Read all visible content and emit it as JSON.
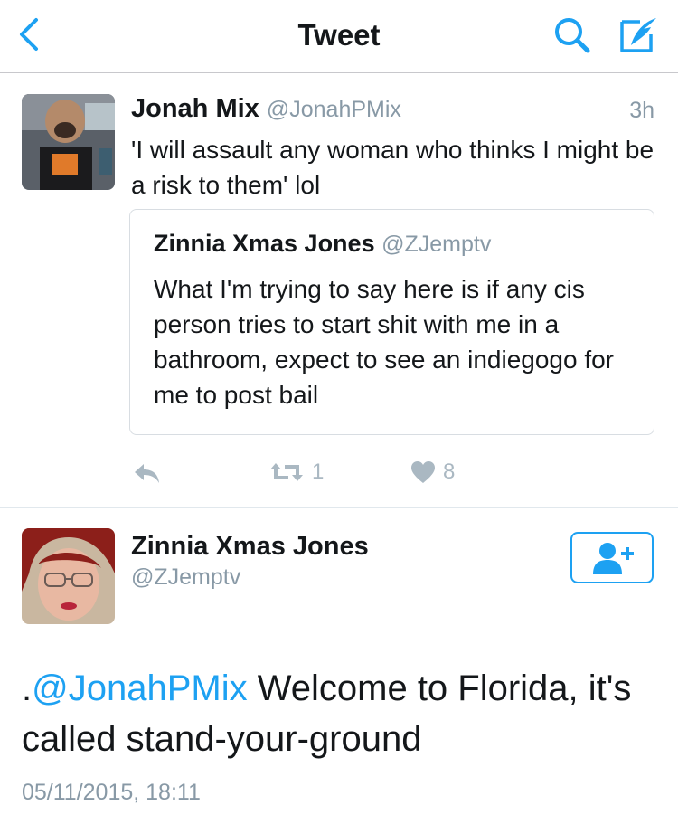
{
  "header": {
    "title": "Tweet"
  },
  "tweet": {
    "author_name": "Jonah Mix",
    "author_handle": "@JonahPMix",
    "time": "3h",
    "text": "'I will assault any woman who thinks I might be a risk to them' lol",
    "quoted": {
      "author_name": "Zinnia Xmas Jones",
      "author_handle": "@ZJemptv",
      "text": "What I'm trying to say here is if any cis person tries to start shit with me in a bathroom, expect to see an indiegogo for me to post bail"
    },
    "actions": {
      "retweet_count": "1",
      "like_count": "8"
    }
  },
  "reply": {
    "author_name": "Zinnia Xmas Jones",
    "author_handle": "@ZJemptv",
    "text_prefix": ".",
    "mention": "@JonahPMix",
    "text_rest": " Welcome to Florida, it's called stand-your-ground",
    "date": "05/11/2015, 18:11"
  },
  "colors": {
    "accent": "#1da1f2",
    "muted": "#8899a6",
    "icon_gray": "#aab8c2"
  }
}
